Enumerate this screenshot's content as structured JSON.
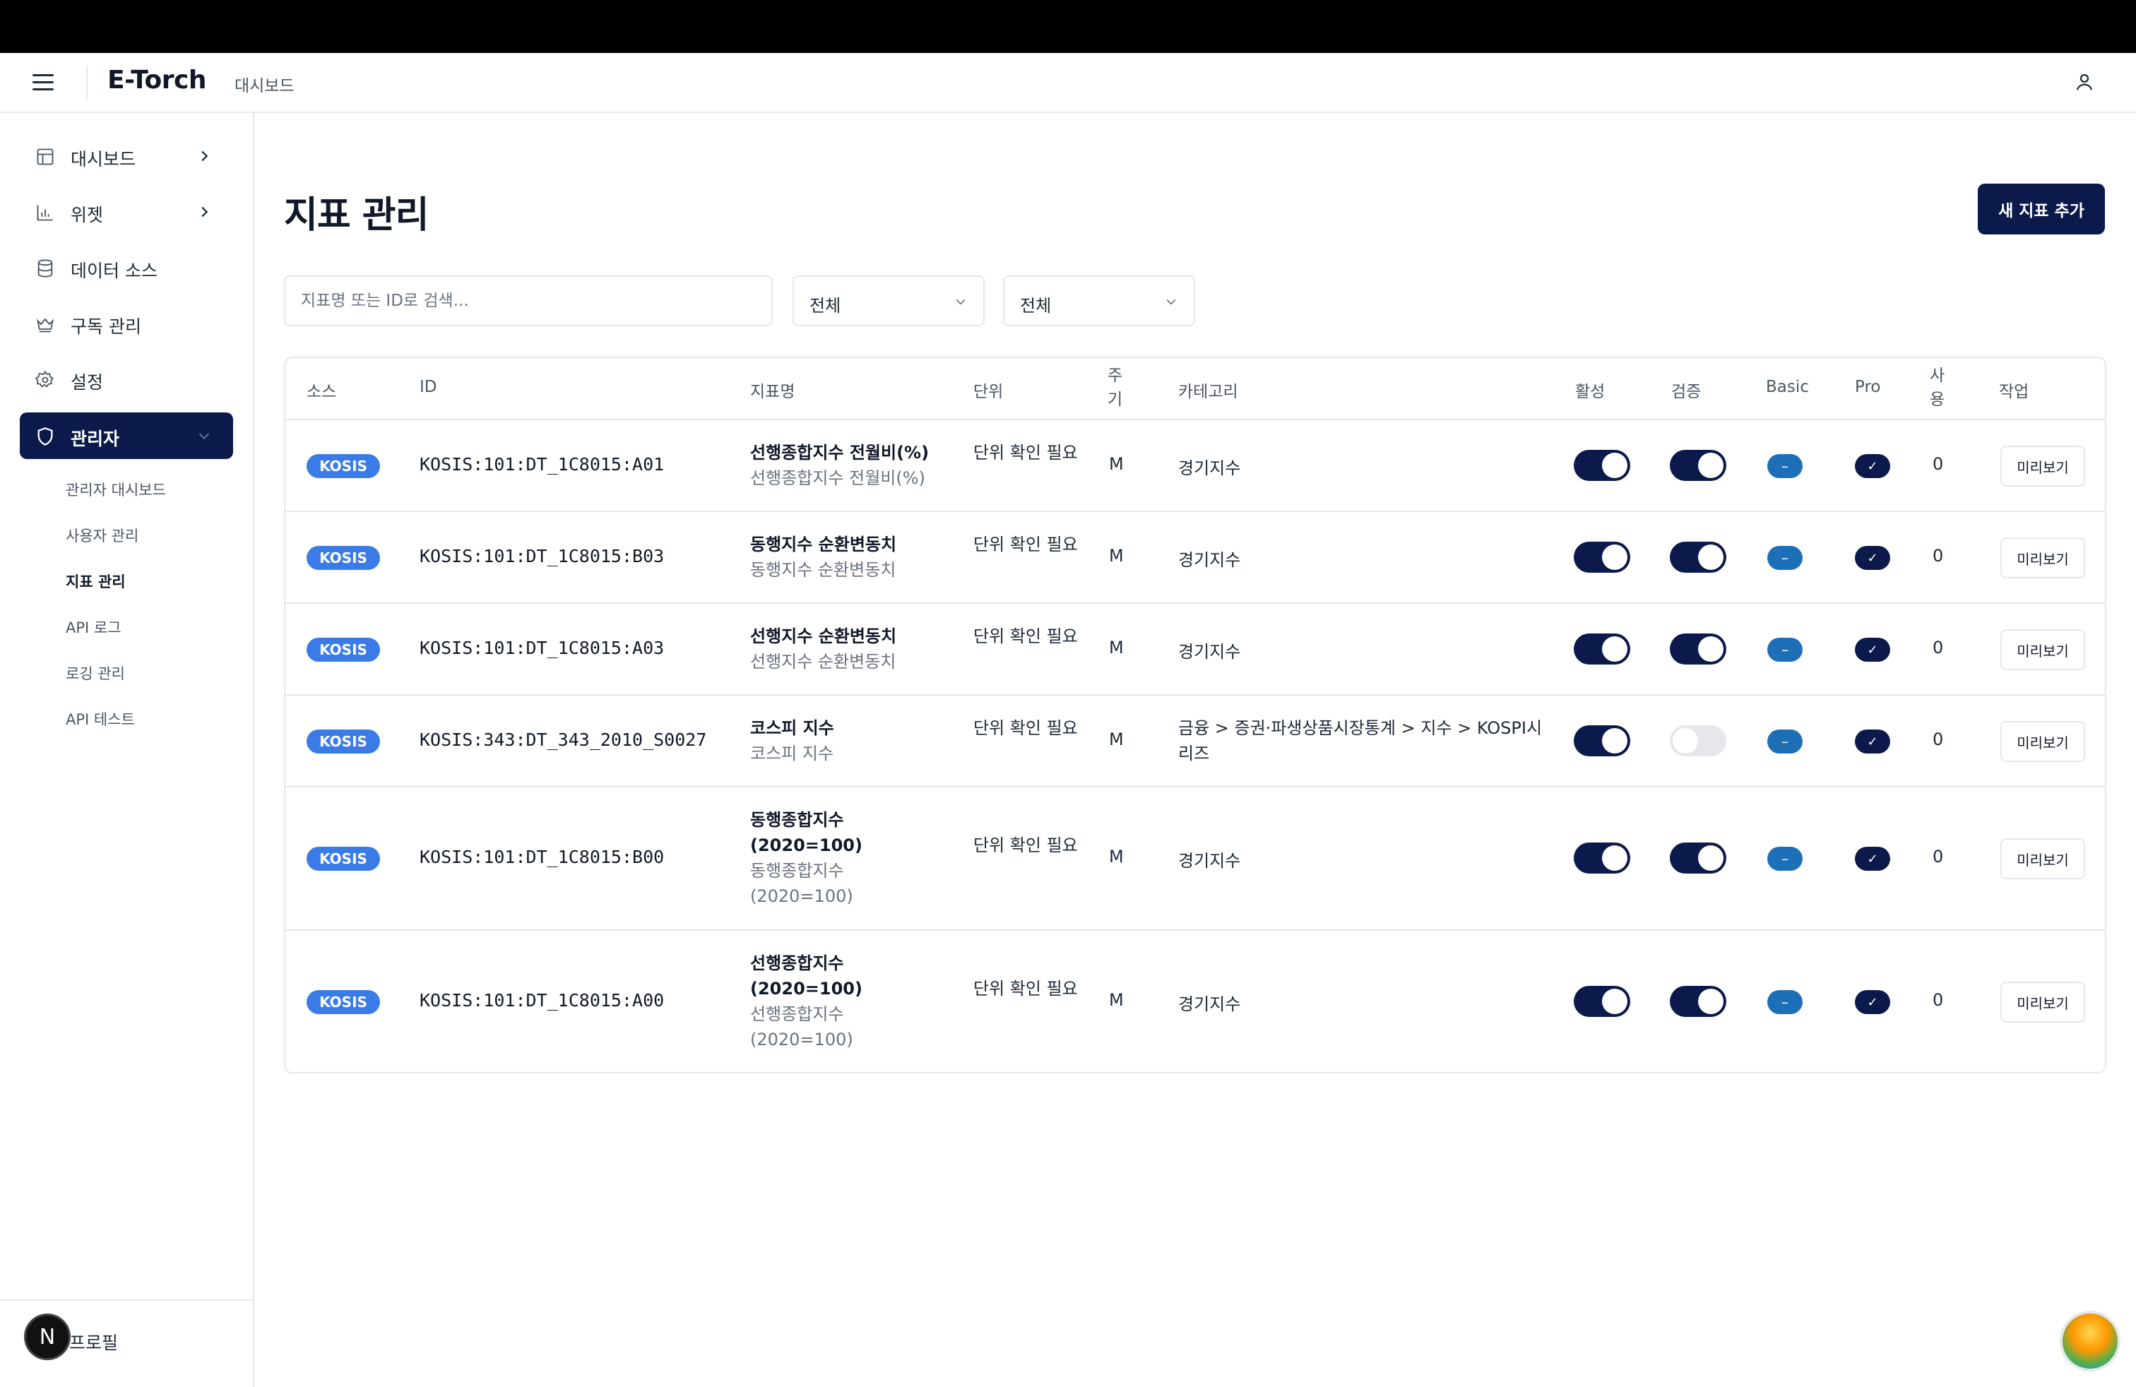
{
  "app": {
    "logo": "E-Torch",
    "header_crumb": "대시보드"
  },
  "sidebar": {
    "items": [
      {
        "label": "대시보드",
        "icon": "layout-icon"
      },
      {
        "label": "위젯",
        "icon": "bar-chart-icon"
      },
      {
        "label": "데이터 소스",
        "icon": "database-icon"
      },
      {
        "label": "구독 관리",
        "icon": "crown-icon"
      },
      {
        "label": "설정",
        "icon": "gear-icon"
      },
      {
        "label": "관리자",
        "icon": "shield-icon"
      }
    ],
    "sub_items": [
      "관리자 대시보드",
      "사용자 관리",
      "지표 관리",
      "API 로그",
      "로깅 관리",
      "API 테스트"
    ],
    "profile_avatar": "N",
    "profile_label": "프로필"
  },
  "page": {
    "title": "지표 관리",
    "add_button": "새 지표 추가",
    "search_placeholder": "지표명 또는 ID로 검색...",
    "filter1": "전체",
    "filter2": "전체"
  },
  "table": {
    "headers": {
      "source": "소스",
      "id": "ID",
      "name": "지표명",
      "unit": "단위",
      "period": "주\n기",
      "category": "카테고리",
      "active": "활성",
      "verified": "검증",
      "basic": "Basic",
      "pro": "Pro",
      "usage": "사\n용",
      "action": "작업"
    },
    "rows": [
      {
        "source": "KOSIS",
        "id": "KOSIS:101:DT_1C8015:A01",
        "name": "선행종합지수 전월비(%)",
        "name_sub": "선행종합지수 전월비(%)",
        "unit": "단위 확인 필요",
        "period": "M",
        "category": "경기지수",
        "active": true,
        "verified": true,
        "basic": "–",
        "pro": "✓",
        "usage": "0",
        "action": "미리보기"
      },
      {
        "source": "KOSIS",
        "id": "KOSIS:101:DT_1C8015:B03",
        "name": "동행지수 순환변동치",
        "name_sub": "동행지수 순환변동치",
        "unit": "단위 확인 필요",
        "period": "M",
        "category": "경기지수",
        "active": true,
        "verified": true,
        "basic": "–",
        "pro": "✓",
        "usage": "0",
        "action": "미리보기"
      },
      {
        "source": "KOSIS",
        "id": "KOSIS:101:DT_1C8015:A03",
        "name": "선행지수 순환변동치",
        "name_sub": "선행지수 순환변동치",
        "unit": "단위 확인 필요",
        "period": "M",
        "category": "경기지수",
        "active": true,
        "verified": true,
        "basic": "–",
        "pro": "✓",
        "usage": "0",
        "action": "미리보기"
      },
      {
        "source": "KOSIS",
        "id": "KOSIS:343:DT_343_2010_S0027",
        "name": "코스피 지수",
        "name_sub": "코스피 지수",
        "unit": "단위 확인 필요",
        "period": "M",
        "category": "금융 > 증권·파생상품시장통계 > 지수 > KOSPI시리즈",
        "active": true,
        "verified": false,
        "basic": "–",
        "pro": "✓",
        "usage": "0",
        "action": "미리보기"
      },
      {
        "source": "KOSIS",
        "id": "KOSIS:101:DT_1C8015:B00",
        "name": "동행종합지수(2020=100)",
        "name_sub": "동행종합지수(2020=100)",
        "unit": "단위 확인 필요",
        "period": "M",
        "category": "경기지수",
        "active": true,
        "verified": true,
        "basic": "–",
        "pro": "✓",
        "usage": "0",
        "action": "미리보기"
      },
      {
        "source": "KOSIS",
        "id": "KOSIS:101:DT_1C8015:A00",
        "name": "선행종합지수(2020=100)",
        "name_sub": "선행종합지수(2020=100)",
        "unit": "단위 확인 필요",
        "period": "M",
        "category": "경기지수",
        "active": true,
        "verified": true,
        "basic": "–",
        "pro": "✓",
        "usage": "0",
        "action": "미리보기"
      }
    ]
  },
  "colors": {
    "primary": "#0b1a4a",
    "badge": "#3b7be8",
    "basic": "#1d6fb8"
  }
}
